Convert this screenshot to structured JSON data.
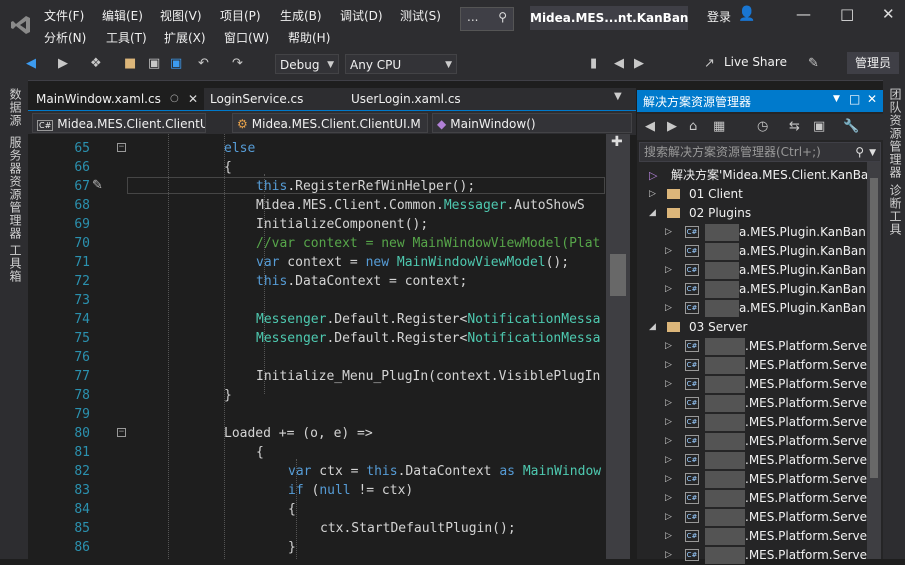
{
  "menu": {
    "row1": [
      "文件(F)",
      "编辑(E)",
      "视图(V)",
      "项目(P)",
      "生成(B)",
      "调试(D)",
      "测试(S)"
    ],
    "row2": [
      "分析(N)",
      "工具(T)",
      "扩展(X)",
      "窗口(W)",
      "帮助(H)"
    ]
  },
  "title": {
    "search_dots": "...",
    "solution_name": "Midea.MES...nt.KanBan",
    "login": "登录"
  },
  "toolbar": {
    "config": "Debug",
    "platform": "Any CPU",
    "live_share": "Live Share",
    "admin": "管理员"
  },
  "left_tabs": [
    "数据源",
    "服务器资源管理器",
    "工具箱"
  ],
  "right_tabs": [
    "团队资源管理器",
    "诊断工具"
  ],
  "doc_tabs": [
    "MainWindow.xaml.cs",
    "LoginService.cs",
    "UserLogin.xaml.cs"
  ],
  "nav": {
    "project": "Midea.MES.Client.ClientUI",
    "class": "Midea.MES.Client.ClientUI.M",
    "member": "MainWindow()"
  },
  "code_lines": [
    {
      "n": "65",
      "t": "else"
    },
    {
      "n": "66",
      "t": "{"
    },
    {
      "n": "67",
      "t": "this.RegisterRefWinHelper();"
    },
    {
      "n": "68",
      "t": "Midea.MES.Client.Common.Messager.AutoShowS"
    },
    {
      "n": "69",
      "t": "InitializeComponent();"
    },
    {
      "n": "70",
      "t": "//var context = new MainWindowViewModel(Plat"
    },
    {
      "n": "71",
      "t": "var context = new MainWindowViewModel();"
    },
    {
      "n": "72",
      "t": "this.DataContext = context;"
    },
    {
      "n": "73",
      "t": ""
    },
    {
      "n": "74",
      "t": "Messenger.Default.Register<NotificationMessa"
    },
    {
      "n": "75",
      "t": "Messenger.Default.Register<NotificationMessa"
    },
    {
      "n": "76",
      "t": ""
    },
    {
      "n": "77",
      "t": "Initialize_Menu_PlugIn(context.VisiblePlugIn"
    },
    {
      "n": "78",
      "t": "}"
    },
    {
      "n": "79",
      "t": ""
    },
    {
      "n": "80",
      "t": "Loaded += (o, e) =>"
    },
    {
      "n": "81",
      "t": "{"
    },
    {
      "n": "82",
      "t": "var ctx = this.DataContext as MainWindow"
    },
    {
      "n": "83",
      "t": "if (null != ctx)"
    },
    {
      "n": "84",
      "t": "{"
    },
    {
      "n": "85",
      "t": "ctx.StartDefaultPlugin();"
    },
    {
      "n": "86",
      "t": "}"
    }
  ],
  "solution_explorer": {
    "title": "解决方案资源管理器",
    "search_placeholder": "搜索解决方案资源管理器(Ctrl+;)",
    "solution": "解决方案'Midea.MES.Client.KanBan",
    "items": [
      {
        "label": "01 Client",
        "kind": "folder",
        "expanded": false
      },
      {
        "label": "02 Plugins",
        "kind": "folder",
        "expanded": true
      },
      {
        "label": "a.MES.Plugin.KanBan.K",
        "kind": "cs"
      },
      {
        "label": "a.MES.Plugin.KanBan.L",
        "kind": "cs"
      },
      {
        "label": "a.MES.Plugin.KanBan.L",
        "kind": "cs"
      },
      {
        "label": "a.MES.Plugin.KanBan.S",
        "kind": "cs"
      },
      {
        "label": "a.MES.Plugin.KanBan.T",
        "kind": "cs"
      },
      {
        "label": "03 Server",
        "kind": "folder",
        "expanded": true
      },
      {
        "label": ".MES.Platform.Server",
        "kind": "cs"
      },
      {
        "label": ".MES.Platform.Server",
        "kind": "cs"
      },
      {
        "label": ".MES.Platform.Server",
        "kind": "cs"
      },
      {
        "label": ".MES.Platform.Server",
        "kind": "cs"
      },
      {
        "label": ".MES.Platform.Server",
        "kind": "cs"
      },
      {
        "label": ".MES.Platform.Server",
        "kind": "cs"
      },
      {
        "label": ".MES.Platform.Server",
        "kind": "cs"
      },
      {
        "label": ".MES.Platform.Server",
        "kind": "cs"
      },
      {
        "label": ".MES.Platform.Server",
        "kind": "cs"
      },
      {
        "label": ".MES.Platform.Server",
        "kind": "cs"
      },
      {
        "label": ".MES.Platform.Server",
        "kind": "cs"
      },
      {
        "label": ".MES.Platform.Server",
        "kind": "cs"
      }
    ]
  },
  "colors": {
    "accent": "#007acc",
    "keyword": "#569cd6",
    "type": "#4ec9b0",
    "comment": "#57a64a",
    "line_number": "#2b91af"
  }
}
